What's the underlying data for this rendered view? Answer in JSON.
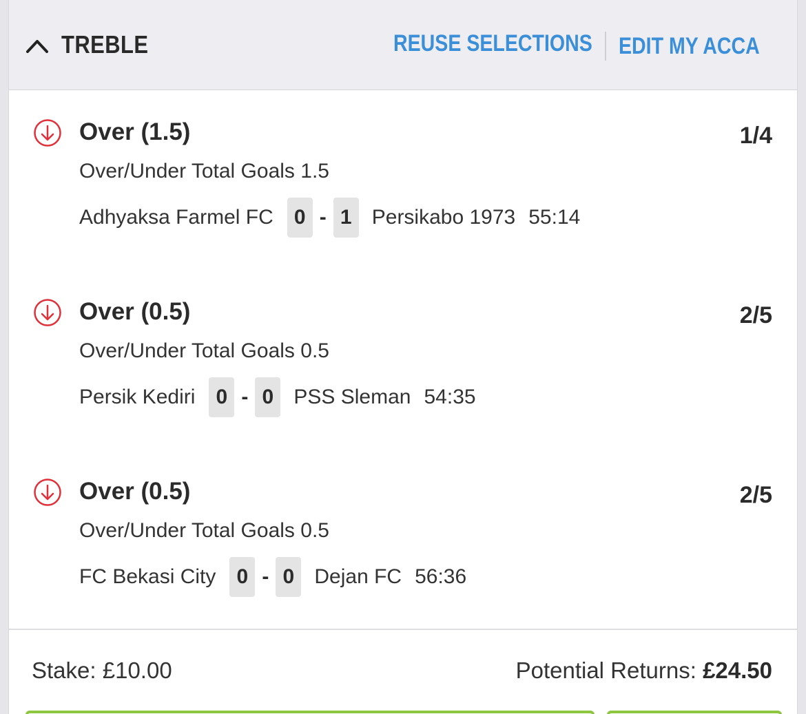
{
  "header": {
    "title": "TREBLE",
    "reuse_label": "REUSE SELECTIONS",
    "edit_label": "EDIT MY ACCA"
  },
  "selections": [
    {
      "name": "Over (1.5)",
      "odds": "1/4",
      "market": "Over/Under Total Goals 1.5",
      "home": "Adhyaksa Farmel FC",
      "home_score": "0",
      "away_score": "1",
      "away": "Persikabo 1973",
      "clock": "55:14"
    },
    {
      "name": "Over (0.5)",
      "odds": "2/5",
      "market": "Over/Under Total Goals 0.5",
      "home": "Persik Kediri",
      "home_score": "0",
      "away_score": "0",
      "away": "PSS Sleman",
      "clock": "54:35"
    },
    {
      "name": "Over (0.5)",
      "odds": "2/5",
      "market": "Over/Under Total Goals 0.5",
      "home": "FC Bekasi City",
      "home_score": "0",
      "away_score": "0",
      "away": "Dejan FC",
      "clock": "56:36"
    }
  ],
  "score_separator": "-",
  "footer": {
    "stake_label": "Stake:",
    "stake_value": "£10.00",
    "returns_label": "Potential Returns:",
    "returns_value": "£24.50"
  },
  "colors": {
    "accent_link": "#3b8fd9",
    "remove_icon": "#e0303a",
    "button_border": "#8dc63f"
  },
  "icons": {
    "collapse": "chevron-up-icon",
    "remove": "arrow-down-circle-icon"
  }
}
